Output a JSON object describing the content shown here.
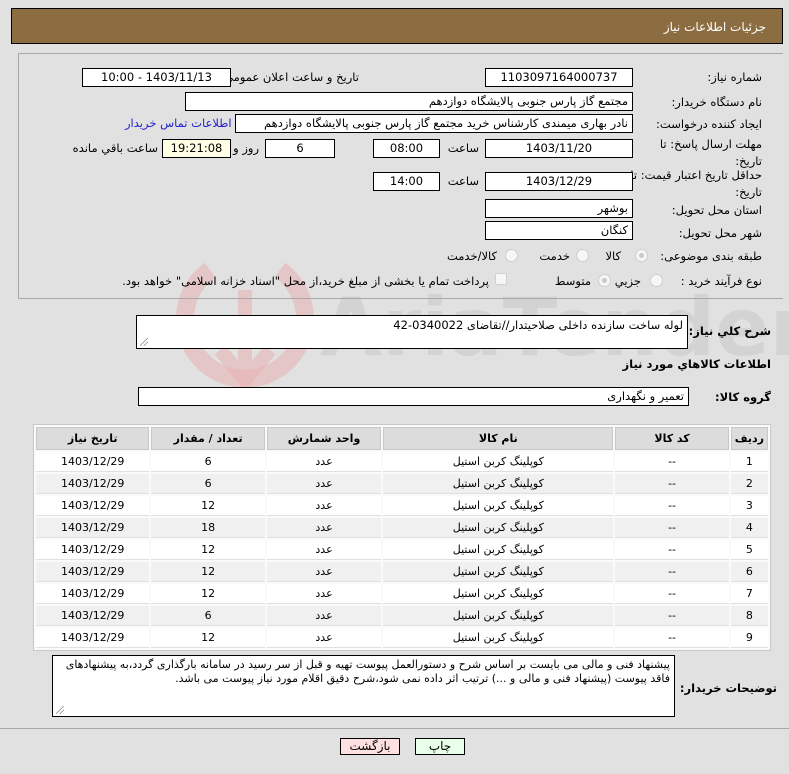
{
  "header": {
    "title": "جزئیات اطلاعات نیاز"
  },
  "form": {
    "need_number": {
      "label": "شماره نیاز:",
      "value": "1103097164000737"
    },
    "announce": {
      "label": "تاریخ و ساعت اعلان عمومي:",
      "value": "1403/11/13 - 10:00"
    },
    "buyer_org": {
      "label": "نام دستگاه خریدار:",
      "value": "مجتمع گاز پارس جنوبی  پالایشگاه دوازدهم"
    },
    "creator": {
      "label": "ایجاد کننده درخواست:",
      "value": "نادر بهاری میمندی کارشناس خرید مجتمع گاز پارس جنوبی  پالایشگاه دوازدهم"
    },
    "buyer_contact_link": "اطلاعات تماس خریدار",
    "deadline": {
      "label": "مهلت ارسال پاسخ: تا تاریخ:",
      "date": "1403/11/20",
      "time_label": "ساعت",
      "time": "08:00",
      "days": "6",
      "days_label": "روز و",
      "remaining": "19:21:08",
      "remaining_label": "ساعت باقي مانده"
    },
    "price_validity": {
      "label": "حداقل تاریخ اعتبار قیمت: تا تاریخ:",
      "date": "1403/12/29",
      "time_label": "ساعت",
      "time": "14:00"
    },
    "province": {
      "label": "استان محل تحویل:",
      "value": "بوشهر"
    },
    "city": {
      "label": "شهر محل تحویل:",
      "value": "کنگان"
    },
    "category": {
      "label": "طبقه بندی موضوعی:",
      "options": [
        {
          "label": "کالا",
          "checked": true
        },
        {
          "label": "خدمت",
          "checked": false
        },
        {
          "label": "کالا/خدمت",
          "checked": false
        }
      ]
    },
    "process": {
      "label": "نوع فرآیند خرید :",
      "options": [
        {
          "label": "جزیي",
          "checked": false
        },
        {
          "label": "متوسط",
          "checked": true
        }
      ],
      "treasury_checkbox": {
        "label": "پرداخت تمام یا بخشی از مبلغ خرید،از محل \"اسناد خزانه اسلامی\" خواهد بود.",
        "checked": false
      }
    }
  },
  "description": {
    "label": "شرح کلي نیاز:",
    "value": "لوله ساخت سازنده داخلی صلاحیتدار//تقاضای 0340022-42"
  },
  "goods_section_title": "اطلاعات کالاهاي مورد نیاز",
  "goods_group": {
    "label": "گروه کالا:",
    "value": "تعمیر و نگهداری"
  },
  "table": {
    "columns": [
      "ردیف",
      "کد کالا",
      "نام کالا",
      "واحد شمارش",
      "تعداد / مقدار",
      "تاریخ نیاز"
    ],
    "rows": [
      [
        "1",
        "--",
        "کوپلینگ کربن استیل",
        "عدد",
        "6",
        "1403/12/29"
      ],
      [
        "2",
        "--",
        "کوپلینگ کربن استیل",
        "عدد",
        "6",
        "1403/12/29"
      ],
      [
        "3",
        "--",
        "کوپلینگ کربن استیل",
        "عدد",
        "12",
        "1403/12/29"
      ],
      [
        "4",
        "--",
        "کوپلینگ کربن استیل",
        "عدد",
        "18",
        "1403/12/29"
      ],
      [
        "5",
        "--",
        "کوپلینگ کربن استیل",
        "عدد",
        "12",
        "1403/12/29"
      ],
      [
        "6",
        "--",
        "کوپلینگ کربن استیل",
        "عدد",
        "12",
        "1403/12/29"
      ],
      [
        "7",
        "--",
        "کوپلینگ کربن استیل",
        "عدد",
        "12",
        "1403/12/29"
      ],
      [
        "8",
        "--",
        "کوپلینگ کربن استیل",
        "عدد",
        "6",
        "1403/12/29"
      ],
      [
        "9",
        "--",
        "کوپلینگ کربن استیل",
        "عدد",
        "12",
        "1403/12/29"
      ]
    ]
  },
  "buyer_notes": {
    "label": "توضیحات خریدار:",
    "value": "پیشنهاد فنی و مالی می بایست بر اساس شرح و دستورالعمل پیوست تهیه و قبل از سر رسید در سامانه بارگذاری گردد،به پیشنهادهای فاقد پیوست (پیشنهاد فنی و مالی و ...) ترتیب اثر داده نمی شود،شرح دقیق اقلام مورد نیاز پیوست می باشد."
  },
  "buttons": {
    "print": "چاپ",
    "back": "بازگشت"
  },
  "watermark": "AriaTender.net",
  "colors": {
    "header": "#8c6d42",
    "print_bg": "#eaffea",
    "back_bg": "#ffe0e0",
    "link": "#2222cc"
  }
}
